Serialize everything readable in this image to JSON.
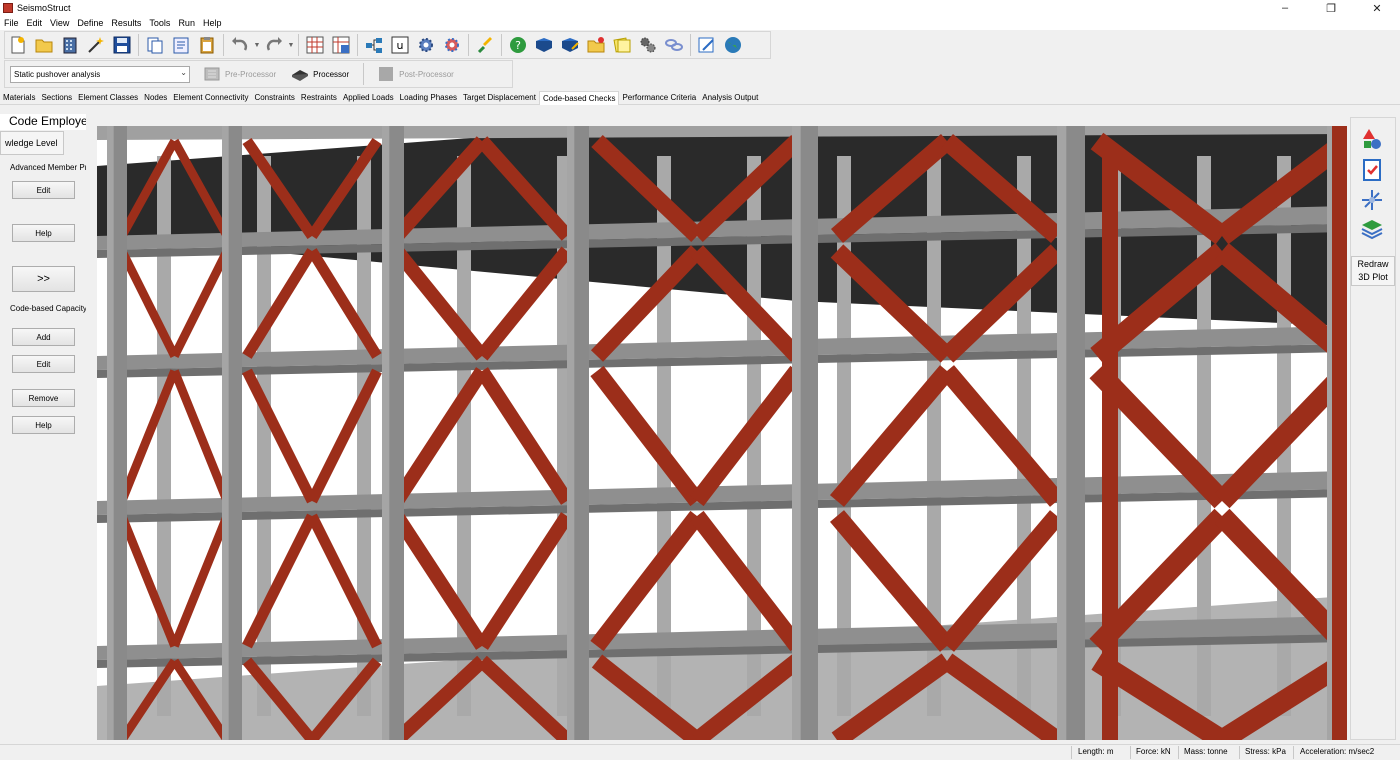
{
  "window": {
    "title": "SeismoStruct"
  },
  "menu": [
    "File",
    "Edit",
    "View",
    "Define",
    "Results",
    "Tools",
    "Run",
    "Help"
  ],
  "toolbar": {
    "icons": [
      "new-file-icon",
      "open-folder-icon",
      "building-wizard-icon",
      "magic-wand-icon",
      "save-icon",
      "copy-icon",
      "paste-icon",
      "clipboard-icon",
      "undo-icon",
      "redo-icon",
      "frame-view-icon",
      "frame-edit-icon",
      "network-icon",
      "u-button-icon",
      "settings-gear-icon",
      "advanced-settings-icon",
      "brush-icon",
      "help-icon",
      "book-icon",
      "book-pen-icon",
      "folder-star-icon",
      "notes-icon",
      "cogs-icon",
      "link-icon",
      "edit-icon",
      "globe-icon"
    ]
  },
  "analysis": {
    "selected": "Static pushover analysis",
    "pre_processor": "Pre-Processor",
    "processor": "Processor",
    "post_processor": "Post-Processor"
  },
  "tabs": [
    "Materials",
    "Sections",
    "Element Classes",
    "Nodes",
    "Element Connectivity",
    "Constraints",
    "Restraints",
    "Applied Loads",
    "Loading Phases",
    "Target Displacement",
    "Code-based Checks",
    "Performance Criteria",
    "Analysis Output"
  ],
  "active_tab": "Code-based Checks",
  "left_panel": {
    "header": "Code Employe",
    "knowledge_label": "wledge Level",
    "advanced_label": "Advanced Member Pr",
    "edit_label": "Edit",
    "help_label": "Help",
    "next_label": ">>",
    "capacity_label": "Code-based Capacity",
    "add_label": "Add",
    "edit2_label": "Edit",
    "remove_label": "Remove",
    "help2_label": "Help"
  },
  "right_panel": {
    "icons": [
      "shapes-icon",
      "checklist-icon",
      "axes-icon",
      "layers-icon"
    ],
    "redraw_line1": "Redraw",
    "redraw_line2": "3D Plot"
  },
  "status": {
    "length": "Length: m",
    "force": "Force: kN",
    "mass": "Mass: tonne",
    "stress": "Stress: kPa",
    "acceleration": "Acceleration: m/sec2"
  },
  "colors": {
    "brace": "#9c2e1a",
    "concrete": "#8f8f8f",
    "slab_dark": "#2a2a2a"
  }
}
